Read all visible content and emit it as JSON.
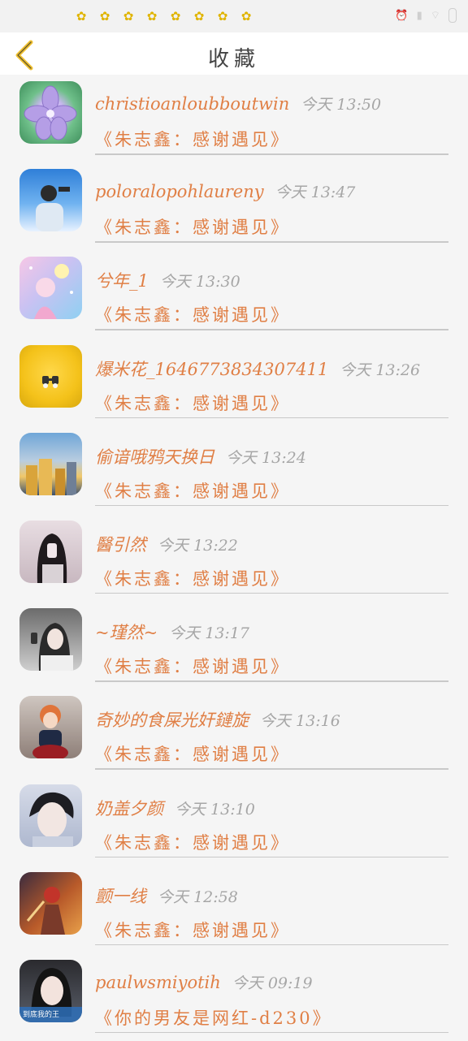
{
  "status_bar": {
    "time": "",
    "battery": "",
    "icons": [
      "flower-icon",
      "flower-icon",
      "flower-icon",
      "flower-icon",
      "flower-icon",
      "flower-icon",
      "flower-icon",
      "flower-icon"
    ]
  },
  "header": {
    "title": "收藏"
  },
  "favorites": [
    {
      "name": "christioanloubboutwin",
      "time": "今天 13:50",
      "work": "《朱志鑫：感谢遇见》"
    },
    {
      "name": "poloralopohlaureny",
      "time": "今天 13:47",
      "work": "《朱志鑫：感谢遇见》"
    },
    {
      "name": "兮年_1",
      "time": "今天 13:30",
      "work": "《朱志鑫：感谢遇见》"
    },
    {
      "name": "爆米花_1646773834307411",
      "time": "今天 13:26",
      "work": "《朱志鑫：感谢遇见》"
    },
    {
      "name": "偷谙哦鸦天换日",
      "time": "今天 13:24",
      "work": "《朱志鑫：感谢遇见》"
    },
    {
      "name": "醫引然",
      "time": "今天 13:22",
      "work": "《朱志鑫：感谢遇见》"
    },
    {
      "name": "~瑾然~",
      "time": "今天 13:17",
      "work": "《朱志鑫：感谢遇见》"
    },
    {
      "name": "奇妙的食屎光奸鏈旋",
      "time": "今天 13:16",
      "work": "《朱志鑫：感谢遇见》"
    },
    {
      "name": "奶盖夕颜",
      "time": "今天 13:10",
      "work": "《朱志鑫：感谢遇见》"
    },
    {
      "name": "颤一线",
      "time": "今天 12:58",
      "work": "《朱志鑫：感谢遇见》"
    },
    {
      "name": "paulwsmiyotih",
      "time": "今天 09:19",
      "work": "《你的男友是网红-d230》",
      "avatar_caption": "到底我的王"
    }
  ],
  "colors": {
    "accent": "#e07f45",
    "back_arrow": "#f1c232",
    "time_gray": "#a6a6a6"
  }
}
